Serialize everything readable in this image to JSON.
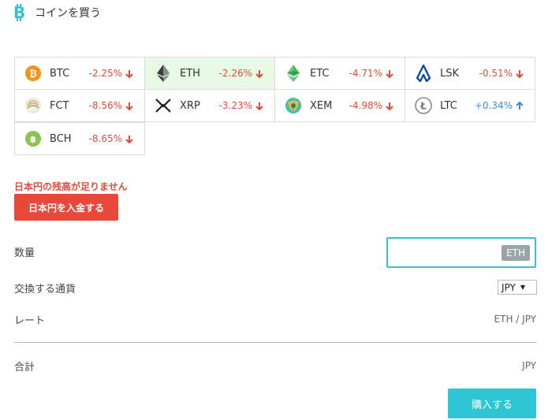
{
  "header": {
    "title": "コインを買う"
  },
  "coins": [
    [
      {
        "symbol": "BTC",
        "change": "-2.25%",
        "dir": "down",
        "icon": "btc-icon",
        "selected": false
      },
      {
        "symbol": "ETH",
        "change": "-2.26%",
        "dir": "down",
        "icon": "eth-icon",
        "selected": true
      },
      {
        "symbol": "ETC",
        "change": "-4.71%",
        "dir": "down",
        "icon": "etc-icon",
        "selected": false
      },
      {
        "symbol": "LSK",
        "change": "-0.51%",
        "dir": "down",
        "icon": "lsk-icon",
        "selected": false
      }
    ],
    [
      {
        "symbol": "FCT",
        "change": "-8.56%",
        "dir": "down",
        "icon": "fct-icon",
        "selected": false
      },
      {
        "symbol": "XRP",
        "change": "-3.23%",
        "dir": "down",
        "icon": "xrp-icon",
        "selected": false
      },
      {
        "symbol": "XEM",
        "change": "-4.98%",
        "dir": "down",
        "icon": "xem-icon",
        "selected": false
      },
      {
        "symbol": "LTC",
        "change": "+0.34%",
        "dir": "up",
        "icon": "ltc-icon",
        "selected": false
      }
    ],
    [
      {
        "symbol": "BCH",
        "change": "-8.65%",
        "dir": "down",
        "icon": "bch-icon",
        "selected": false
      }
    ]
  ],
  "warning": "日本円の残高が足りません",
  "deposit_button": "日本円を入金する",
  "form": {
    "quantity_label": "数量",
    "quantity_value": "",
    "quantity_unit": "ETH",
    "currency_label": "交換する通貨",
    "currency_selected": "JPY",
    "rate_label": "レート",
    "rate_unit": "ETH / JPY",
    "total_label": "合計",
    "total_unit": "JPY"
  },
  "buy_button": "購入する",
  "colors": {
    "accent": "#2ec6d4",
    "danger": "#e8493a",
    "down": "#e24b3c",
    "up": "#3a8fd6",
    "selected_bg": "#e6fae6"
  }
}
